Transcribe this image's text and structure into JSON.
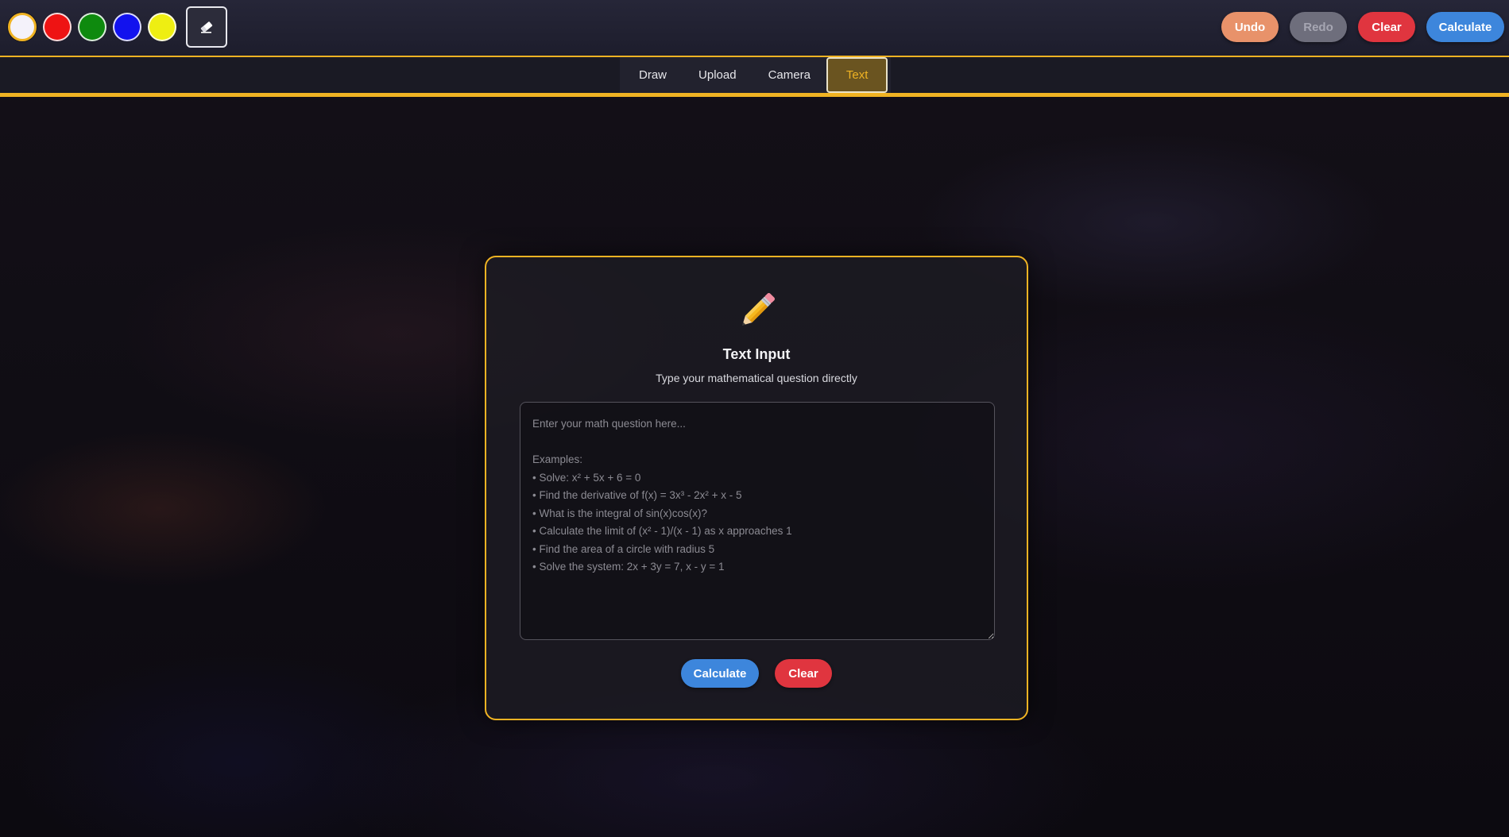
{
  "toolbar": {
    "colors": [
      {
        "name": "white",
        "hex": "#f4f2fa",
        "selected": true
      },
      {
        "name": "red",
        "hex": "#ee1313"
      },
      {
        "name": "green",
        "hex": "#0e8a0e"
      },
      {
        "name": "blue",
        "hex": "#1212ee"
      },
      {
        "name": "yellow",
        "hex": "#eeee12"
      }
    ],
    "eraser_icon": "eraser-icon",
    "undo_label": "Undo",
    "redo_label": "Redo",
    "clear_label": "Clear",
    "calculate_label": "Calculate"
  },
  "tabs": [
    {
      "label": "Draw",
      "active": false
    },
    {
      "label": "Upload",
      "active": false
    },
    {
      "label": "Camera",
      "active": false
    },
    {
      "label": "Text",
      "active": true
    }
  ],
  "card": {
    "icon": "pencil-icon",
    "title": "Text Input",
    "subtitle": "Type your mathematical question directly",
    "input_value": "",
    "input_placeholder": "Enter your math question here...\n\nExamples:\n• Solve: x² + 5x + 6 = 0\n• Find the derivative of f(x) = 3x³ - 2x² + x - 5\n• What is the integral of sin(x)cos(x)?\n• Calculate the limit of (x² - 1)/(x - 1) as x approaches 1\n• Find the area of a circle with radius 5\n• Solve the system: 2x + 3y = 7, x - y = 1",
    "calculate_label": "Calculate",
    "clear_label": "Clear"
  },
  "theme": {
    "accent": "#f0b323",
    "calculate_blue": "#3d86dc",
    "clear_red": "#e0353f",
    "undo_orange": "#e8926a"
  }
}
